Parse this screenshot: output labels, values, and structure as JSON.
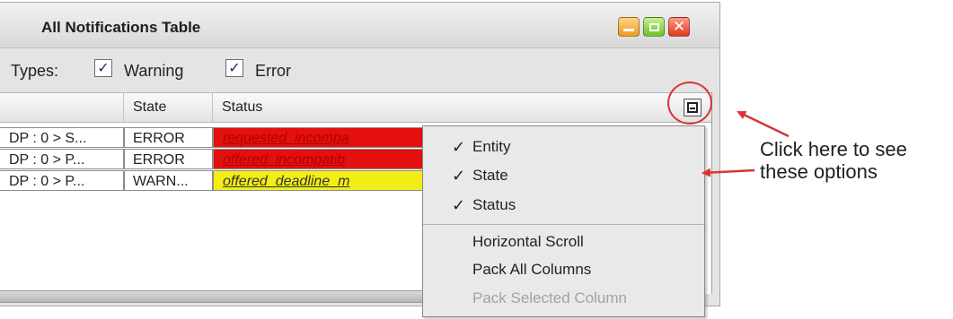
{
  "window": {
    "title": "All Notifications Table"
  },
  "types": {
    "label": "Types:",
    "options": [
      {
        "label": "Warning",
        "checked": true
      },
      {
        "label": "Error",
        "checked": true
      }
    ]
  },
  "table": {
    "columns": [
      "",
      "State",
      "Status"
    ],
    "rows": [
      {
        "entity": "DP : 0 > S...",
        "state": "ERROR",
        "status": "requested_incompa",
        "status_bg": "#e40f0f"
      },
      {
        "entity": "DP : 0 > P...",
        "state": "ERROR",
        "status": "offered_incompatib",
        "status_bg": "#e40f0f"
      },
      {
        "entity": "DP : 0 > P...",
        "state": "WARN...",
        "status": "offered_deadline_m",
        "status_bg": "#f2ee15"
      }
    ]
  },
  "column_menu": {
    "check_mark": "✓",
    "column_items": [
      {
        "label": "Entity",
        "checked": true
      },
      {
        "label": "State",
        "checked": true
      },
      {
        "label": "Status",
        "checked": true
      }
    ],
    "action_items": [
      {
        "label": "Horizontal Scroll",
        "enabled": true
      },
      {
        "label": "Pack All Columns",
        "enabled": true
      },
      {
        "label": "Pack Selected Column",
        "enabled": false
      }
    ]
  },
  "annotation": {
    "line1": "Click here to see",
    "line2": "these options",
    "color": "#d93434"
  }
}
